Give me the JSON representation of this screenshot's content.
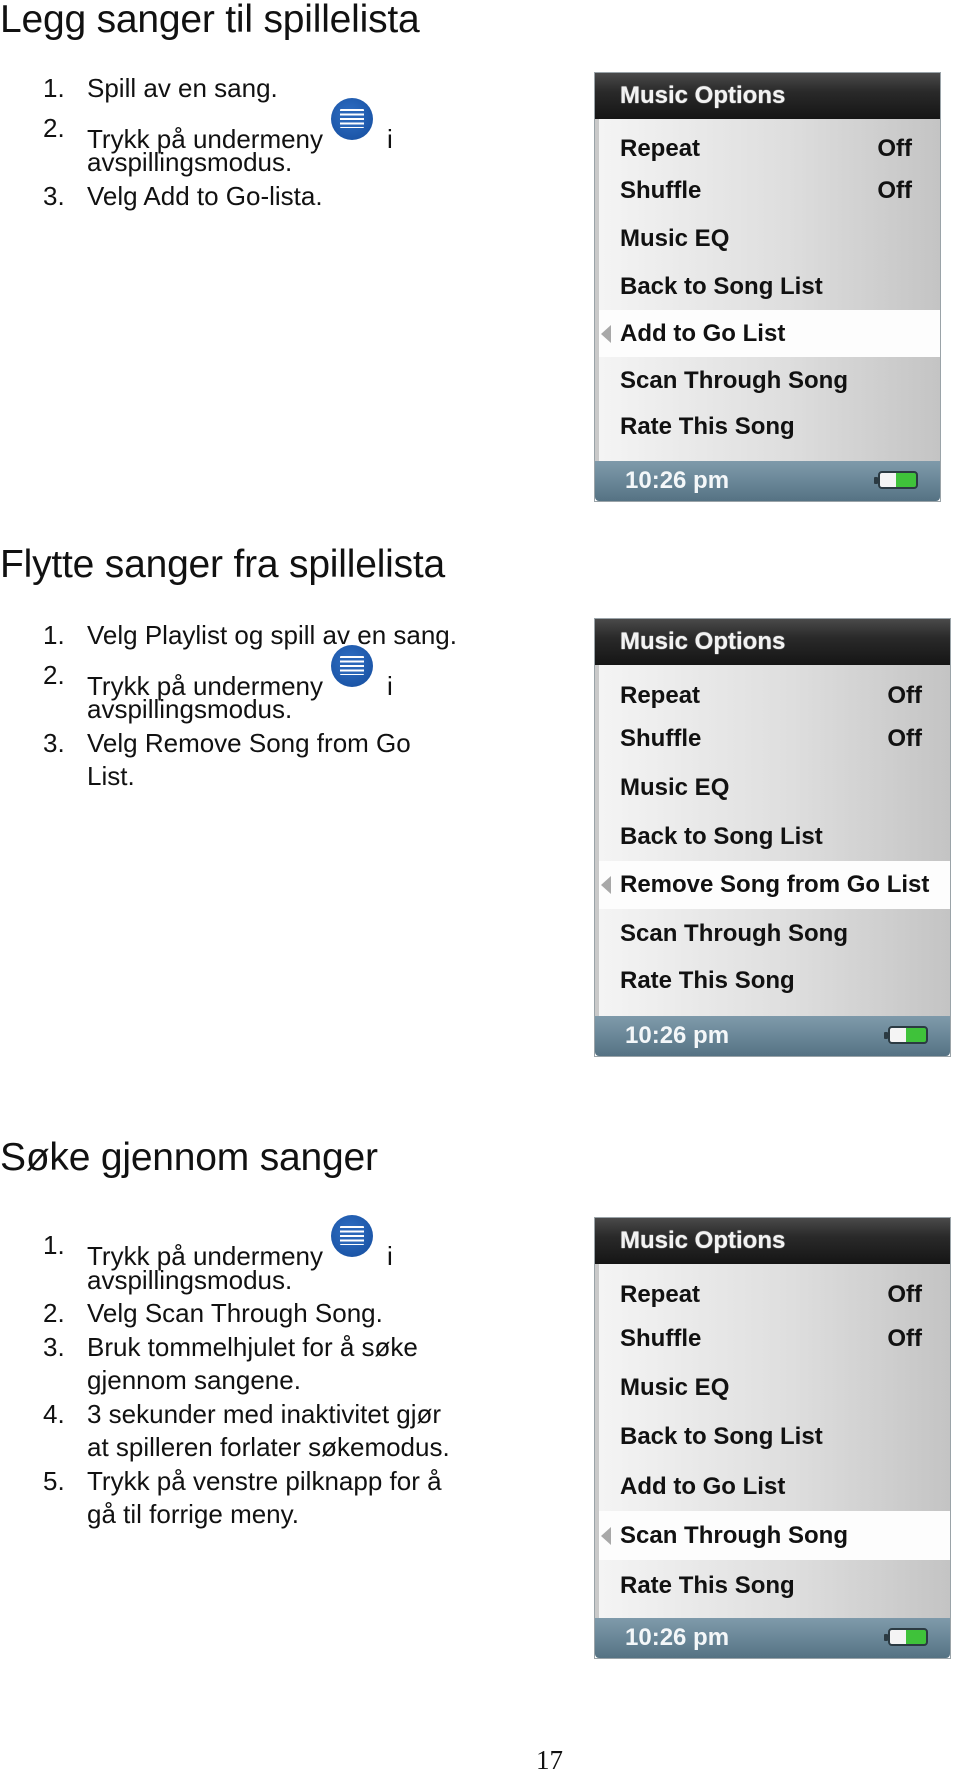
{
  "sections": [
    {
      "title": "Legg sanger til spillelista",
      "steps": [
        {
          "num": "1.",
          "lines": [
            "Spill av en sang."
          ]
        },
        {
          "num": "2.",
          "before_icon": "Trykk på undermeny",
          "after_icon": "i",
          "lines": [
            "avspillingsmodus."
          ],
          "icon": "submenu-icon"
        },
        {
          "num": "3.",
          "lines": [
            "Velg Add to Go-lista."
          ]
        }
      ],
      "screen": {
        "title": "Music Options",
        "items": [
          {
            "label": "Repeat",
            "value": "Off"
          },
          {
            "label": "Shuffle",
            "value": "Off"
          },
          {
            "label": "Music EQ",
            "value": ""
          },
          {
            "label": "Back to Song List",
            "value": ""
          },
          {
            "label": "Add to Go List",
            "value": "",
            "selected": true
          },
          {
            "label": "Scan Through Song",
            "value": ""
          },
          {
            "label": "Rate This Song",
            "value": ""
          }
        ],
        "time": "10:26 pm",
        "battery_icon": "battery-icon"
      }
    },
    {
      "title": "Flytte sanger fra spillelista",
      "steps": [
        {
          "num": "1.",
          "lines": [
            "Velg Playlist og spill av en sang."
          ]
        },
        {
          "num": "2.",
          "before_icon": "Trykk på undermeny",
          "after_icon": "i",
          "lines": [
            "avspillingsmodus."
          ],
          "icon": "submenu-icon"
        },
        {
          "num": "3.",
          "lines": [
            "Velg Remove Song from Go",
            "List."
          ]
        }
      ],
      "screen": {
        "title": "Music Options",
        "items": [
          {
            "label": "Repeat",
            "value": "Off"
          },
          {
            "label": "Shuffle",
            "value": "Off"
          },
          {
            "label": "Music EQ",
            "value": ""
          },
          {
            "label": "Back to Song List",
            "value": ""
          },
          {
            "label": "Remove Song from Go List",
            "value": "",
            "selected": true
          },
          {
            "label": "Scan Through Song",
            "value": ""
          },
          {
            "label": "Rate This Song",
            "value": ""
          }
        ],
        "time": "10:26 pm",
        "battery_icon": "battery-icon"
      }
    },
    {
      "title": "Søke gjennom sanger",
      "steps": [
        {
          "num": "1.",
          "before_icon": "Trykk på undermeny",
          "after_icon": "i",
          "lines": [
            "avspillingsmodus."
          ],
          "icon": "submenu-icon"
        },
        {
          "num": "2.",
          "lines": [
            "Velg Scan Through Song."
          ]
        },
        {
          "num": "3.",
          "lines": [
            "Bruk tommelhjulet for å søke",
            "gjennom sangene."
          ]
        },
        {
          "num": "4.",
          "lines": [
            "3 sekunder med inaktivitet gjør",
            "at spilleren forlater søkemodus."
          ]
        },
        {
          "num": "5.",
          "lines": [
            "Trykk på venstre pilknapp for å",
            "gå til forrige meny."
          ]
        }
      ],
      "screen": {
        "title": "Music Options",
        "items": [
          {
            "label": "Repeat",
            "value": "Off"
          },
          {
            "label": "Shuffle",
            "value": "Off"
          },
          {
            "label": "Music EQ",
            "value": ""
          },
          {
            "label": "Back to Song List",
            "value": ""
          },
          {
            "label": "Add to Go List",
            "value": ""
          },
          {
            "label": "Scan Through Song",
            "value": "",
            "selected": true
          },
          {
            "label": "Rate This Song",
            "value": ""
          }
        ],
        "time": "10:26 pm",
        "battery_icon": "battery-icon"
      }
    }
  ],
  "page_number": "17"
}
